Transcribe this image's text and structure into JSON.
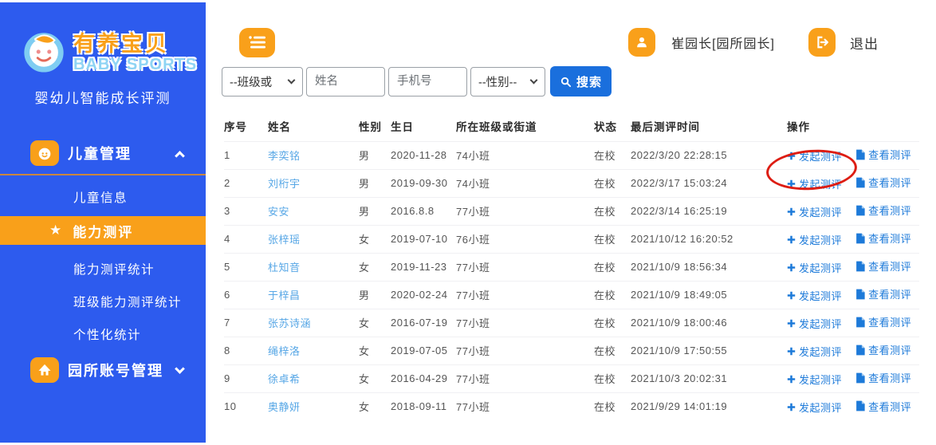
{
  "brand": {
    "name_cn": "有养宝贝",
    "name_en": "BABY SPORTS",
    "tagline": "婴幼儿智能成长评测"
  },
  "colors": {
    "sidebar_blue": "#2d5bee",
    "accent_orange": "#f9a01a",
    "search_blue": "#1a6fdd",
    "link_blue": "#1d7ad9",
    "name_blue": "#57a7e6",
    "annotation_red": "#dd1d13"
  },
  "sidebar": {
    "items": [
      {
        "label": "儿童管理",
        "icon": "baby-icon",
        "chevron": "up"
      },
      {
        "label": "儿童信息"
      },
      {
        "label": "能力测评",
        "icon": "star-icon",
        "active": true
      },
      {
        "label": "能力测评统计"
      },
      {
        "label": "班级能力测评统计"
      },
      {
        "label": "个性化统计"
      },
      {
        "label": "园所账号管理",
        "icon": "school-icon",
        "chevron": "down"
      }
    ]
  },
  "topbar": {
    "user_name": "崔园长[园所园长]",
    "logout_label": "退出"
  },
  "filters": {
    "class_select_value": "--班级或",
    "name_placeholder": "姓名",
    "phone_placeholder": "手机号",
    "gender_select_value": "--性别--",
    "search_label": "搜索"
  },
  "table": {
    "headers": [
      "序号",
      "姓名",
      "性别",
      "生日",
      "所在班级或街道",
      "状态",
      "最后测评时间",
      "操作"
    ],
    "ops": {
      "launch": "发起测评",
      "view": "查看测评"
    },
    "rows": [
      {
        "no": "1",
        "name": "李奕铭",
        "gender": "男",
        "birthday": "2020-11-28",
        "class": "74小班",
        "status": "在校",
        "last_time": "2022/3/20 22:28:15"
      },
      {
        "no": "2",
        "name": "刘桁宇",
        "gender": "男",
        "birthday": "2019-09-30",
        "class": "74小班",
        "status": "在校",
        "last_time": "2022/3/17 15:03:24"
      },
      {
        "no": "3",
        "name": "安安",
        "gender": "男",
        "birthday": "2016.8.8",
        "class": "77小班",
        "status": "在校",
        "last_time": "2022/3/14 16:25:19"
      },
      {
        "no": "4",
        "name": "张梓瑶",
        "gender": "女",
        "birthday": "2019-07-10",
        "class": "76小班",
        "status": "在校",
        "last_time": "2021/10/12 16:20:52"
      },
      {
        "no": "5",
        "name": "杜知音",
        "gender": "女",
        "birthday": "2019-11-23",
        "class": "77小班",
        "status": "在校",
        "last_time": "2021/10/9 18:56:34"
      },
      {
        "no": "6",
        "name": "于梓昌",
        "gender": "男",
        "birthday": "2020-02-24",
        "class": "77小班",
        "status": "在校",
        "last_time": "2021/10/9 18:49:05"
      },
      {
        "no": "7",
        "name": "张苏诗涵",
        "gender": "女",
        "birthday": "2016-07-19",
        "class": "77小班",
        "status": "在校",
        "last_time": "2021/10/9 18:00:46"
      },
      {
        "no": "8",
        "name": "绳梓洛",
        "gender": "女",
        "birthday": "2019-07-05",
        "class": "77小班",
        "status": "在校",
        "last_time": "2021/10/9 17:50:55"
      },
      {
        "no": "9",
        "name": "徐卓希",
        "gender": "女",
        "birthday": "2016-04-29",
        "class": "77小班",
        "status": "在校",
        "last_time": "2021/10/3 20:02:31"
      },
      {
        "no": "10",
        "name": "奥静妍",
        "gender": "女",
        "birthday": "2018-09-11",
        "class": "77小班",
        "status": "在校",
        "last_time": "2021/9/29 14:01:19"
      }
    ]
  }
}
